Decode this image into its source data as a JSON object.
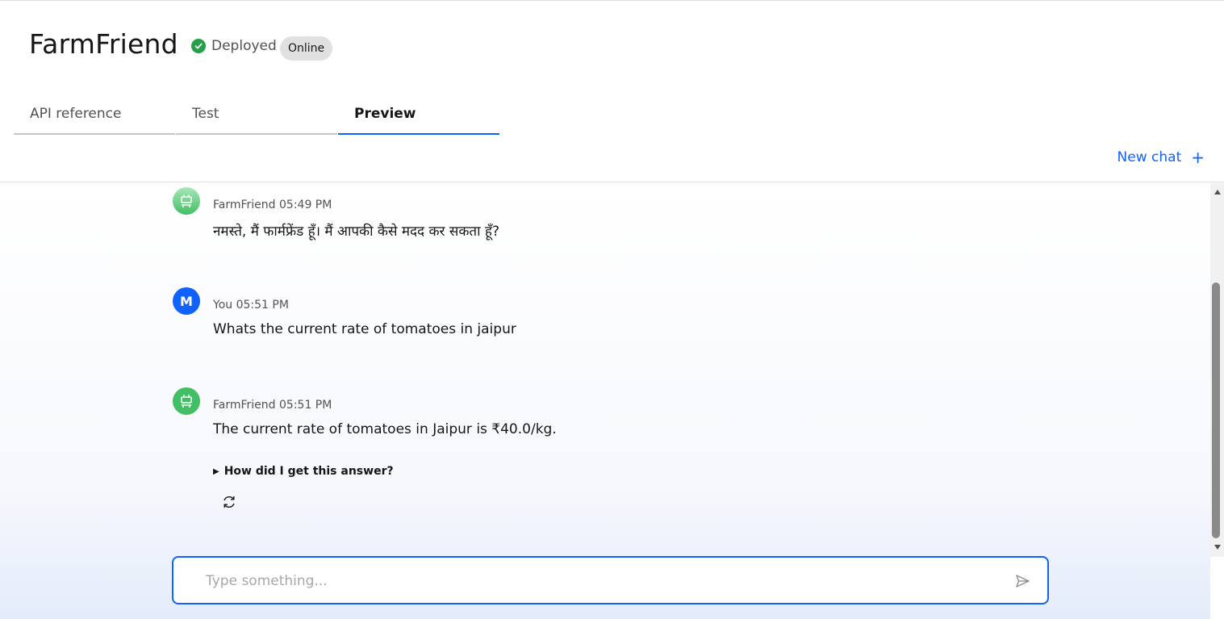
{
  "header": {
    "title": "FarmFriend",
    "status_label": "Deployed",
    "badge_label": "Online",
    "status_color": "#24a148"
  },
  "tabs": [
    {
      "label": "API reference",
      "active": false
    },
    {
      "label": "Test",
      "active": false
    },
    {
      "label": "Preview",
      "active": true
    }
  ],
  "new_chat": {
    "label": "New chat",
    "icon": "plus-icon"
  },
  "messages": [
    {
      "sender": "FarmFriend",
      "time": "05:49 PM",
      "avatar": "robot-icon",
      "text": "नमस्ते, मैं फार्मफ्रेंड हूँ। मैं आपकी कैसे मदद कर सकता हूँ?"
    },
    {
      "sender": "You",
      "time": "05:51 PM",
      "avatar_letter": "M",
      "text": "Whats the current rate of tomatoes in jaipur"
    },
    {
      "sender": "FarmFriend",
      "time": "05:51 PM",
      "avatar": "robot-icon",
      "text": "The current rate of tomatoes in Jaipur is ₹40.0/kg.",
      "details_label": "How did I get this answer?",
      "action_icon": "refresh-icon"
    }
  ],
  "input": {
    "placeholder": "Type something...",
    "value": "",
    "send_icon": "send-icon"
  },
  "colors": {
    "accent": "#0f62fe",
    "bot_avatar": "#42be65",
    "user_avatar": "#0f62fe"
  }
}
